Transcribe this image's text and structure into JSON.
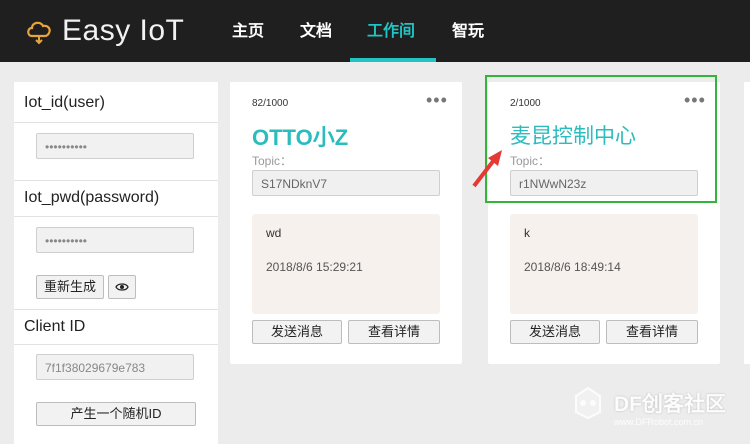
{
  "app": {
    "logo_text": "Easy IoT"
  },
  "nav": {
    "items": [
      {
        "label": "主页"
      },
      {
        "label": "文档"
      },
      {
        "label": "工作间",
        "active": true
      },
      {
        "label": "智玩"
      }
    ]
  },
  "left_panel": {
    "iot_id_label": "Iot_id(user)",
    "iot_id_value": "••••••••••",
    "iot_pwd_label": "Iot_pwd(password)",
    "iot_pwd_value": "••••••••••",
    "regenerate_button": "重新生成",
    "client_id_label": "Client ID",
    "client_id_value": "7f1f38029679e783",
    "random_id_button": "产生一个随机ID"
  },
  "cards": [
    {
      "count": "82/1000",
      "title": "OTTO小Z",
      "topic_label": "Topic：",
      "topic_value": "S17NDknV7",
      "message_text": "wd",
      "message_time": "2018/8/6 15:29:21",
      "send_button": "发送消息",
      "details_button": "查看详情"
    },
    {
      "count": "2/1000",
      "title": "麦昆控制中心",
      "topic_label": "Topic：",
      "topic_value": "r1NWwN23z",
      "message_text": "k",
      "message_time": "2018/8/6 18:49:14",
      "send_button": "发送消息",
      "details_button": "查看详情"
    }
  ],
  "watermark": {
    "text": "DF创客社区",
    "url": "www.DFRobot.com.cn"
  },
  "colors": {
    "accent": "#22c3c3",
    "highlight": "#33b53a",
    "arrow": "#e53935",
    "topbar": "#1f1f1f"
  }
}
